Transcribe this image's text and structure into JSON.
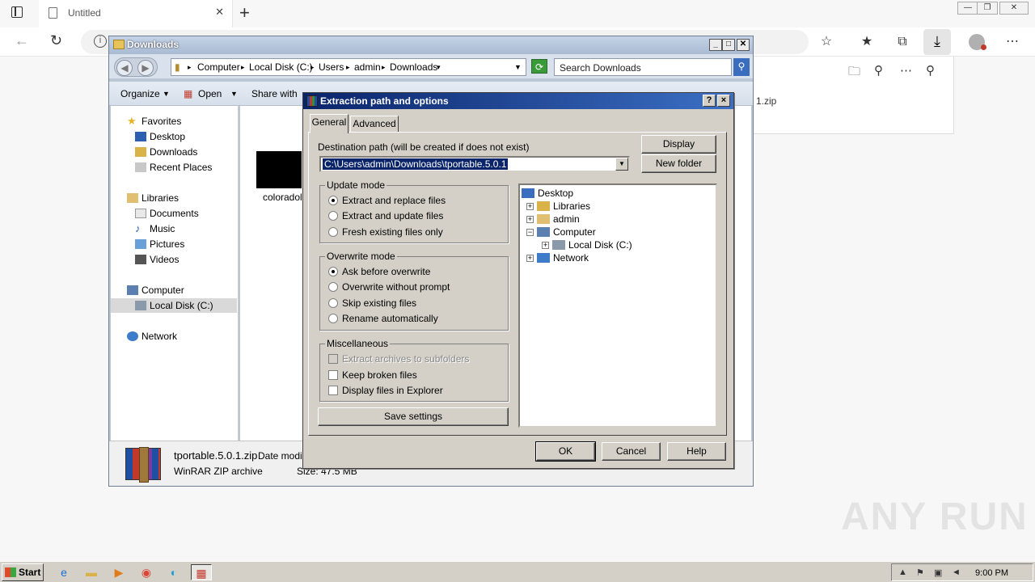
{
  "browser": {
    "tab_title": "Untitled",
    "download_panel": {
      "file_name_partial": "1.zip"
    }
  },
  "explorer": {
    "title": "Downloads",
    "breadcrumb": [
      "Computer",
      "Local Disk (C:)",
      "Users",
      "admin",
      "Downloads"
    ],
    "search_placeholder": "Search Downloads",
    "commands": {
      "organize": "Organize",
      "open": "Open",
      "share_with": "Share with"
    },
    "sidebar": {
      "favorites": "Favorites",
      "desktop": "Desktop",
      "downloads": "Downloads",
      "recent_places": "Recent Places",
      "libraries": "Libraries",
      "documents": "Documents",
      "music": "Music",
      "pictures": "Pictures",
      "videos": "Videos",
      "computer": "Computer",
      "local_disk": "Local Disk (C:)",
      "network": "Network"
    },
    "file_thumb_label": "coloradoli",
    "details": {
      "file_name": "tportable.5.0.1.zip",
      "date_label": "Date modif",
      "type": "WinRAR ZIP archive",
      "size": "Size: 47.5 MB"
    }
  },
  "dialog": {
    "title": "Extraction path and options",
    "help_btn": "?",
    "close_btn": "×",
    "tabs": [
      "General",
      "Advanced"
    ],
    "dest_label": "Destination path (will be created if does not exist)",
    "dest_value": "C:\\Users\\admin\\Downloads\\tportable.5.0.1",
    "display_btn": "Display",
    "new_folder_btn": "New folder",
    "update_mode": {
      "title": "Update mode",
      "options": [
        "Extract and replace files",
        "Extract and update files",
        "Fresh existing files only"
      ],
      "selected": 0
    },
    "overwrite_mode": {
      "title": "Overwrite mode",
      "options": [
        "Ask before overwrite",
        "Overwrite without prompt",
        "Skip existing files",
        "Rename automatically"
      ],
      "selected": 0
    },
    "misc": {
      "title": "Miscellaneous",
      "extract_subfolders": "Extract archives to subfolders",
      "keep_broken": "Keep broken files",
      "display_explorer": "Display files in Explorer"
    },
    "save_settings": "Save settings",
    "tree": {
      "desktop": "Desktop",
      "libraries": "Libraries",
      "admin": "admin",
      "computer": "Computer",
      "local_disk": "Local Disk (C:)",
      "network": "Network"
    },
    "ok": "OK",
    "cancel": "Cancel",
    "help": "Help"
  },
  "taskbar": {
    "start": "Start",
    "clock": "9:00 PM"
  },
  "watermark": "ANY RUN"
}
